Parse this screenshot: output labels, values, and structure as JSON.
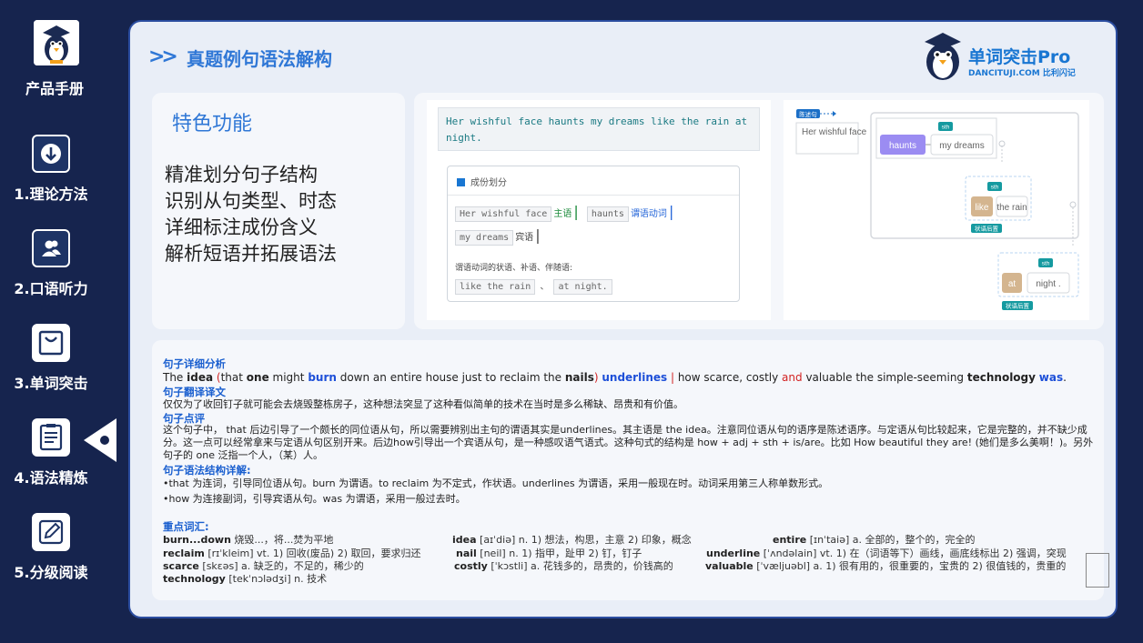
{
  "sidebar": {
    "title": "产品手册",
    "items": [
      {
        "label": "1.理论方法",
        "icon": "download-circle-icon"
      },
      {
        "label": "2.口语听力",
        "icon": "people-icon"
      },
      {
        "label": "3.单词突击",
        "icon": "bag-icon"
      },
      {
        "label": "4.语法精炼",
        "icon": "document-list-icon"
      },
      {
        "label": "5.分级阅读",
        "icon": "pen-edit-icon"
      }
    ]
  },
  "header": {
    "arrows": ">>",
    "title": "真题例句语法解构",
    "brand_title": "单词突击Pro",
    "brand_sub": "DANCITUJI.COM 比利闪记"
  },
  "feature": {
    "title": "特色功能",
    "items": [
      "精准划分句子结构",
      "识别从句类型、时态",
      "详细标注成份含义",
      "解析短语并拓展语法"
    ]
  },
  "demo": {
    "sentence": "Her wishful face haunts my dreams like the rain at night.",
    "panel_title": "成份划分",
    "chips": {
      "subject_phrase": "Her wishful face",
      "subject_tag": "主语",
      "verb": "haunts",
      "verb_tag": "谓语动词",
      "object": "my dreams",
      "object_tag": "宾语",
      "adverbial_label": "谓语动词的状语、补语、伴随语:",
      "adv1": "like the rain",
      "sep": "、",
      "adv2": "at night."
    },
    "tree": {
      "root_tag": "陈述句",
      "subject": "Her wishful face",
      "verb": "haunts",
      "object": "my dreams",
      "sth_tag": "sth",
      "prep1": "like",
      "obj1": "the rain",
      "adv_tag": "状语后置",
      "prep2": "at",
      "obj2": "night ."
    }
  },
  "analysis": {
    "h1": "句子详细分析",
    "sentence_parts": [
      {
        "text": "The ",
        "style": ""
      },
      {
        "text": "idea",
        "style": "kw"
      },
      {
        "text": " (",
        "style": "red"
      },
      {
        "text": "that ",
        "style": ""
      },
      {
        "text": "one",
        "style": "kw"
      },
      {
        "text": " might ",
        "style": ""
      },
      {
        "text": "burn",
        "style": "blue"
      },
      {
        "text": " down an entire house just to reclaim the ",
        "style": ""
      },
      {
        "text": "nails",
        "style": "kw"
      },
      {
        "text": ") ",
        "style": "red"
      },
      {
        "text": "underlines",
        "style": "blue"
      },
      {
        "text": " | ",
        "style": "red"
      },
      {
        "text": "how scarce, costly ",
        "style": ""
      },
      {
        "text": "and",
        "style": "red"
      },
      {
        "text": " valuable the simple-seeming ",
        "style": ""
      },
      {
        "text": "technology",
        "style": "kw"
      },
      {
        "text": " ",
        "style": ""
      },
      {
        "text": "was",
        "style": "blue"
      },
      {
        "text": ".",
        "style": ""
      }
    ],
    "h2": "句子翻译译文",
    "translation": "仅仅为了收回钉子就可能会去烧毁整栋房子，这种想法突显了这种看似简单的技术在当时是多么稀缺、昂贵和有价值。",
    "h3": "句子点评",
    "review": "这个句子中，  that 后边引导了一个颇长的同位语从句，所以需要辨别出主句的谓语其实是underlines。其主语是 the idea。注意同位语从句的语序是陈述语序。与定语从句比较起来，它是完整的，并不缺少成分。这一点可以经常拿来与定语从句区别开来。后边how引导出一个宾语从句，是一种感叹语气语式。这种句式的结构是 how + adj + sth + is/are。比如 How beautiful they are! (她们是多么美啊！)。另外句子的 one 泛指一个人，（某）人。",
    "h4": "句子语法结构详解:",
    "detail1": "•that 为连词，引导同位语从句。burn 为谓语。to reclaim 为不定式，作状语。underlines 为谓语，采用一般现在时。动词采用第三人称单数形式。",
    "detail2": "•how 为连接副词，引导宾语从句。was 为谓语，采用一般过去时。",
    "h5": "重点词汇:",
    "vocab": [
      {
        "word": "burn...down",
        "def": "  烧毁...，将...焚为平地"
      },
      {
        "word": "idea",
        "def": "  [aɪˈdiə] n. 1) 想法，构思，主意 2) 印象，概念"
      },
      {
        "word": "entire",
        "def": "  [ɪnˈtaiə] a. 全部的，整个的，完全的"
      },
      {
        "word": "reclaim",
        "def": "  [rɪˈkleim] vt. 1) 回收(废品) 2) 取回，要求归还"
      },
      {
        "word": "nail",
        "def": "  [neil] n. 1) 指甲，趾甲 2) 钉，钉子"
      },
      {
        "word": "underline",
        "def": "  [ˈʌndəlain] vt. 1) 在（词语等下）画线，画底线标出 2) 强调，突现"
      },
      {
        "word": "scarce",
        "def": "  [skɛəs] a. 缺乏的，不足的，稀少的"
      },
      {
        "word": "costly",
        "def": "  [ˈkɔstli] a. 花钱多的，昂贵的，价钱高的"
      },
      {
        "word": "valuable",
        "def": "  [ˈvæljuəbl] a. 1) 很有用的，很重要的，宝贵的 2) 很值钱的，贵重的"
      },
      {
        "word": "technology",
        "def": "  [tekˈnɔlədʒi] n. 技术"
      }
    ]
  },
  "colors": {
    "sidebar_bg": "#16244e",
    "accent": "#2f77d6",
    "tree_verb": "#9b8cf2",
    "tree_prep": "#d4b58f",
    "tree_tag": "#159aa0"
  }
}
